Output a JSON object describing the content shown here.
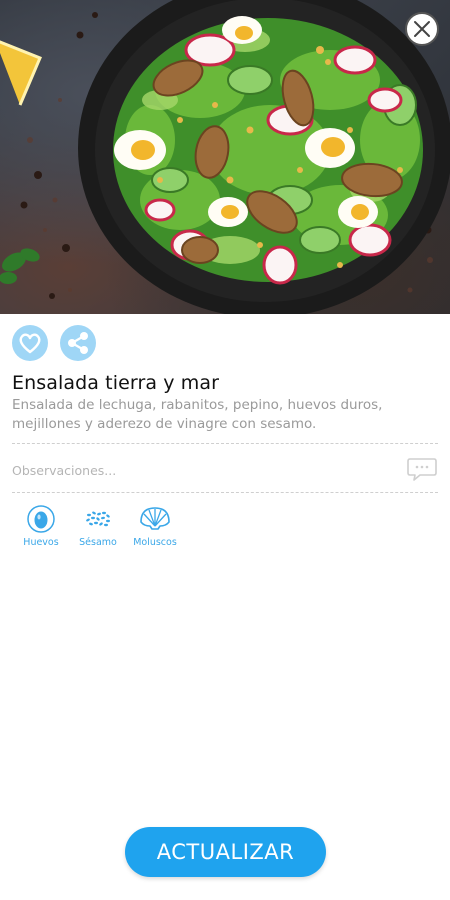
{
  "dish": {
    "title": "Ensalada tierra y mar",
    "description": "Ensalada de lechuga, rabanitos, pepino, huevos duros, mejillones y aderezo de vinagre con sesamo."
  },
  "notes": {
    "placeholder": "Observaciones..."
  },
  "allergens": [
    {
      "label": "Huevos",
      "icon": "egg-icon"
    },
    {
      "label": "Sésamo",
      "icon": "sesame-icon"
    },
    {
      "label": "Moluscos",
      "icon": "shell-icon"
    }
  ],
  "actions": {
    "update_label": "ACTUALIZAR"
  },
  "colors": {
    "accent": "#1fa3ee",
    "icon_light": "#9fd6f6",
    "allergen_label": "#3aa7e8"
  }
}
